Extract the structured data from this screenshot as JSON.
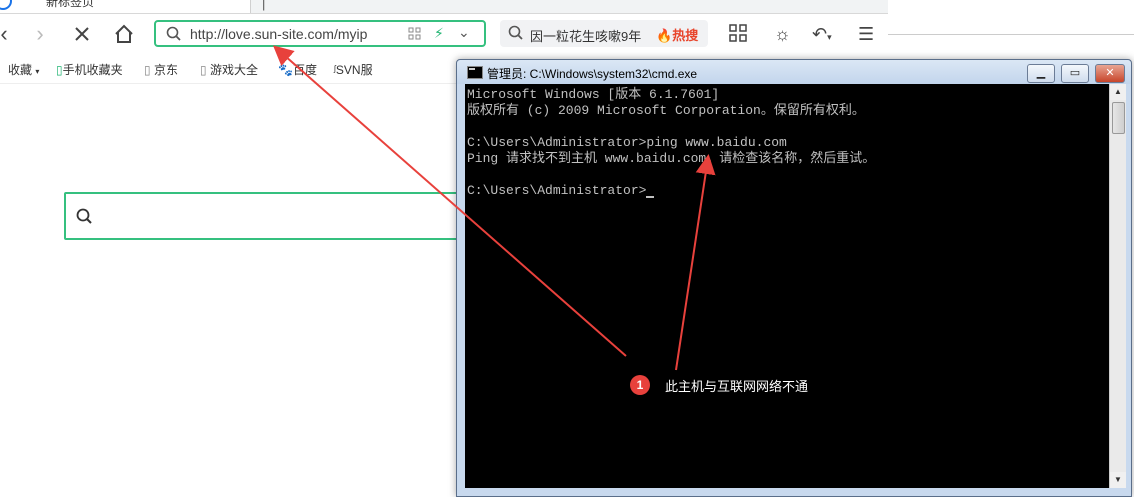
{
  "browser": {
    "tab_title": "新标签页",
    "newtab_label": "|",
    "url": "http://love.sun-site.com/myip",
    "hot_search": {
      "query": "因一粒花生咳嗽9年",
      "badge": "热搜"
    },
    "bookmarks": [
      {
        "label": "收藏",
        "icon": "star-icon"
      },
      {
        "label": "手机收藏夹",
        "icon": "phone-icon"
      },
      {
        "label": "京东",
        "icon": "page-icon"
      },
      {
        "label": "游戏大全",
        "icon": "page-icon"
      },
      {
        "label": "百度",
        "icon": "paw-icon"
      },
      {
        "label": "SVN服",
        "icon": "svn-icon"
      }
    ]
  },
  "cmd": {
    "title": "管理员: C:\\Windows\\system32\\cmd.exe",
    "lines": [
      "Microsoft Windows [版本 6.1.7601]",
      "版权所有 (c) 2009 Microsoft Corporation。保留所有权利。",
      "",
      "C:\\Users\\Administrator>ping www.baidu.com",
      "Ping 请求找不到主机 www.baidu.com。请检查该名称，然后重试。",
      "",
      "C:\\Users\\Administrator>"
    ]
  },
  "annotation": {
    "number": "1",
    "text": "此主机与互联网网络不通",
    "color": "#e8413c"
  }
}
